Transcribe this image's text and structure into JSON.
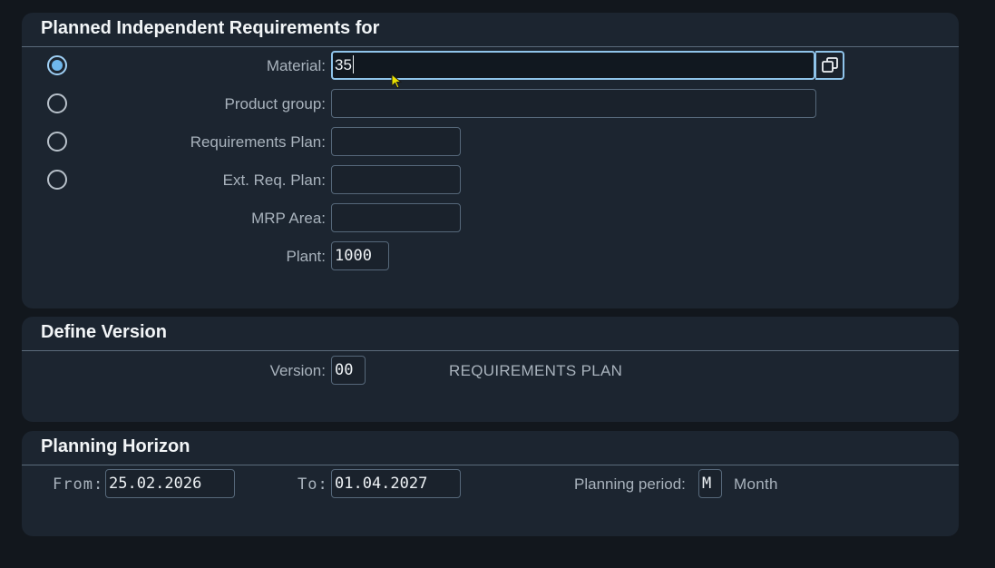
{
  "requirements_section": {
    "title": "Planned Independent Requirements for",
    "material_label": "Material:",
    "material_value": "35",
    "product_group_label": "Product group:",
    "product_group_value": "",
    "requirements_plan_label": "Requirements Plan:",
    "requirements_plan_value": "",
    "ext_req_plan_label": "Ext. Req. Plan:",
    "ext_req_plan_value": "",
    "mrp_area_label": "MRP Area:",
    "mrp_area_value": "",
    "plant_label": "Plant:",
    "plant_value": "1000",
    "selected_option": "material"
  },
  "version_section": {
    "title": "Define Version",
    "version_label": "Version:",
    "version_value": "00",
    "version_description": "REQUIREMENTS PLAN"
  },
  "horizon_section": {
    "title": "Planning Horizon",
    "from_label": "From:",
    "from_value": "25.02.2026",
    "to_label": "To:",
    "to_value": "01.04.2027",
    "period_label": "Planning period:",
    "period_value": "M",
    "period_description": "Month"
  },
  "icons": {
    "value_help": "value-help-icon",
    "mouse_cursor": "mouse-pointer-icon"
  },
  "colors": {
    "background": "#12171d",
    "panel": "#1c2530",
    "focus_accent": "#8fc4ea",
    "radio_selected": "#6fb7ec",
    "cursor": "#e8e000"
  }
}
